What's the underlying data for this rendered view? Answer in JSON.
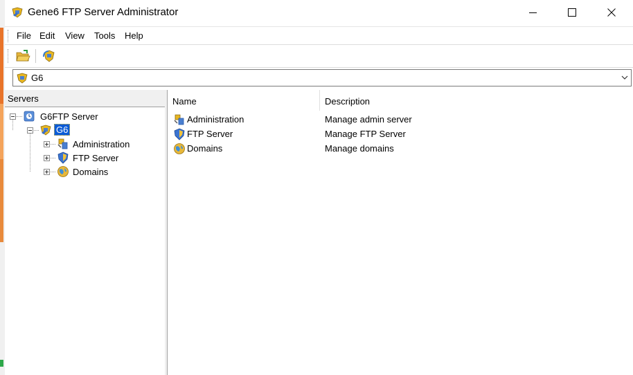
{
  "window": {
    "title": "Gene6 FTP Server Administrator"
  },
  "menubar": {
    "items": [
      "File",
      "Edit",
      "View",
      "Tools",
      "Help"
    ]
  },
  "toolbar": {
    "buttons": [
      "open-folder-icon",
      "refresh-server-icon"
    ]
  },
  "server_combo": {
    "value": "G6"
  },
  "tree": {
    "header": "Servers",
    "root": {
      "label": "G6FTP Server",
      "icon": "ftp-server-root-icon"
    },
    "server": {
      "label": "G6",
      "icon": "server-icon"
    },
    "children": [
      {
        "label": "Administration",
        "icon": "admin-icon"
      },
      {
        "label": "FTP Server",
        "icon": "shield-icon"
      },
      {
        "label": "Domains",
        "icon": "globe-icon"
      }
    ]
  },
  "list": {
    "columns": [
      "Name",
      "Description"
    ],
    "rows": [
      {
        "name": "Administration",
        "description": "Manage admin server",
        "icon": "admin-icon"
      },
      {
        "name": "FTP Server",
        "description": "Manage FTP Server",
        "icon": "shield-icon"
      },
      {
        "name": "Domains",
        "description": "Manage domains",
        "icon": "globe-icon"
      }
    ]
  },
  "colors": {
    "selection": "#0a5bd6",
    "panel_bg": "#f0f0f0"
  }
}
